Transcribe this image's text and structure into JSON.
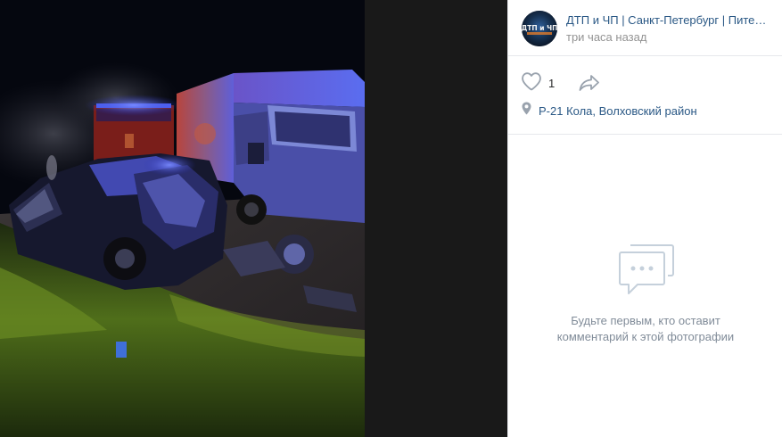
{
  "post": {
    "author": "ДТП и ЧП | Санкт-Петербург | Питер Онлайн | СПб",
    "time": "три часа назад",
    "avatar_text": "ДТП и ЧП"
  },
  "actions": {
    "like_count": "1",
    "place": "Р-21 Кола, Волховский район"
  },
  "comments": {
    "empty_line1": "Будьте первым, кто оставит",
    "empty_line2": "комментарий к этой фотографии"
  },
  "colors": {
    "link": "#2a5885",
    "muted": "#939393",
    "icon": "#99a2ad",
    "divider": "#e7e8ec",
    "viewer_bg": "#191919"
  },
  "icons": {
    "like": "heart-outline-icon",
    "share": "share-arrow-icon",
    "place": "location-pin-icon",
    "empty": "chat-bubbles-icon"
  }
}
